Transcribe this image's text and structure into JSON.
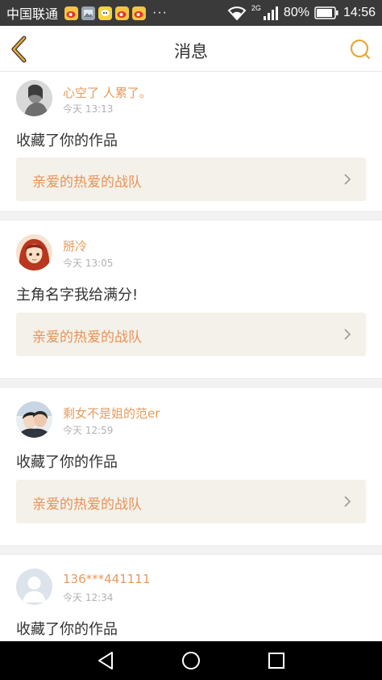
{
  "status_bar": {
    "carrier": "中国联通",
    "dots": "···",
    "network_type": "2G",
    "battery": "80%",
    "time": "14:56",
    "notification_icons": [
      "weibo-icon",
      "image-icon",
      "chat-icon",
      "weibo-icon",
      "weibo-icon"
    ]
  },
  "header": {
    "title": "消息",
    "back_icon": "back-arrow-icon",
    "search_icon": "search-icon",
    "accent_color": "#e8a838"
  },
  "messages": [
    {
      "username": "心空了 人累了。",
      "time": "今天 13:13",
      "content": "收藏了你的作品",
      "card_title": "亲爱的热爱的战队",
      "avatar": "avatar-photo-gray"
    },
    {
      "username": "掰冷",
      "time": "今天 13:05",
      "content": "主角名字我给满分!",
      "card_title": "亲爱的热爱的战队",
      "avatar": "avatar-anime-girl"
    },
    {
      "username": "剩女不是姐的范er",
      "time": "今天 12:59",
      "content": "收藏了你的作品",
      "card_title": "亲爱的热爱的战队",
      "avatar": "avatar-couple-photo"
    },
    {
      "username": "136***441111",
      "time": "今天 12:34",
      "content": "收藏了你的作品",
      "card_title": "",
      "avatar": "avatar-default"
    }
  ],
  "colors": {
    "username": "#e89a5c",
    "card_bg": "#f3f1e9",
    "card_text": "#e8935a",
    "separator": "#f2f2f2"
  }
}
